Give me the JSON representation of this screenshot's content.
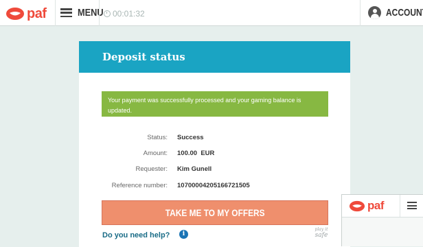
{
  "topbar": {
    "logo_text": "paf",
    "menu_label": "MENU",
    "session_timer": "00:01:32",
    "account_label": "ACCOUNT"
  },
  "deposit": {
    "title": "Deposit status",
    "message": "Your payment was successfully processed and your gaming balance is updated.",
    "details": [
      {
        "label": "Status:",
        "value": "Success"
      },
      {
        "label": "Amount:",
        "value": "100.00  EUR"
      },
      {
        "label": "Requester:",
        "value": "Kim Gunell"
      },
      {
        "label": "Reference number:",
        "value": "10700004205166721505"
      }
    ],
    "cta_label": "TAKE ME TO MY OFFERS",
    "help_text": "Do you need help?",
    "info_icon_glyph": "i",
    "safe_logo_top": "play it",
    "safe_logo_bottom": "safe"
  },
  "mini_window": {
    "logo_text": "paf"
  },
  "colors": {
    "brand_red": "#ef4a3b",
    "header_blue": "#1aa4c3",
    "success_green": "#87b842",
    "cta_orange": "#ef8f6d",
    "help_blue": "#186b86"
  },
  "icons": [
    "paf-logo-icon",
    "hamburger-menu-icon",
    "clock-icon",
    "account-icon",
    "info-icon",
    "play-it-safe-logo"
  ]
}
